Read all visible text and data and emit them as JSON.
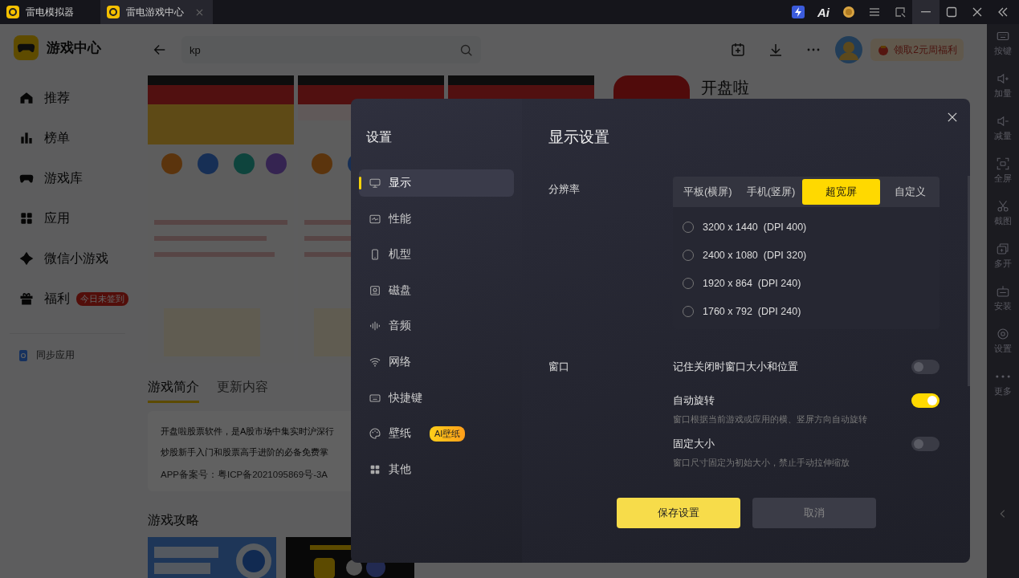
{
  "title_bar": {
    "tabs": [
      {
        "label": "雷电模拟器",
        "selected": false,
        "closable": false
      },
      {
        "label": "雷电游戏中心",
        "selected": true,
        "closable": true
      }
    ],
    "ai_label": "Ai"
  },
  "sidebar": {
    "title": "游戏中心",
    "items": [
      {
        "label": "推荐",
        "kind": "home"
      },
      {
        "label": "榜单",
        "kind": "chart"
      },
      {
        "label": "游戏库",
        "kind": "gamepad"
      },
      {
        "label": "应用",
        "kind": "apps"
      },
      {
        "label": "微信小游戏",
        "kind": "diamond"
      },
      {
        "label": "福利",
        "kind": "gift",
        "badge": "今日未签到"
      }
    ],
    "sync": "同步应用"
  },
  "header": {
    "search": {
      "value": "kp"
    },
    "reward_button": "领取2元周福利"
  },
  "app": {
    "name": "开盘啦",
    "tabs": [
      {
        "label": "游戏简介",
        "selected": true
      },
      {
        "label": "更新内容",
        "selected": false
      }
    ],
    "description_lines": [
      "开盘啦股票软件，是A股市场中集实时沪深行",
      "炒股新手入门和股票高手进阶的必备免费掌"
    ],
    "icp": "APP备案号：粤ICP备2021095869号-3A",
    "guides_title": "游戏攻略"
  },
  "right_toolbar": [
    {
      "label": "按键",
      "kind": "keyboard"
    },
    {
      "label": "加量",
      "kind": "volume-up"
    },
    {
      "label": "减量",
      "kind": "volume-down"
    },
    {
      "label": "全屏",
      "kind": "fullscreen"
    },
    {
      "label": "截图",
      "kind": "scissors"
    },
    {
      "label": "多开",
      "kind": "multi"
    },
    {
      "label": "安装",
      "kind": "install"
    },
    {
      "label": "设置",
      "kind": "settings"
    },
    {
      "label": "更多",
      "kind": "more"
    }
  ],
  "dialog": {
    "title": "设置",
    "nav": [
      {
        "label": "显示",
        "kind": "monitor",
        "selected": true
      },
      {
        "label": "性能",
        "kind": "pulse",
        "selected": false
      },
      {
        "label": "机型",
        "kind": "phone",
        "selected": false
      },
      {
        "label": "磁盘",
        "kind": "disk",
        "selected": false
      },
      {
        "label": "音频",
        "kind": "wave",
        "selected": false
      },
      {
        "label": "网络",
        "kind": "wifi",
        "selected": false
      },
      {
        "label": "快捷键",
        "kind": "keyboard",
        "selected": false
      },
      {
        "label": "壁纸",
        "kind": "palette",
        "selected": false,
        "badge": "AI壁纸"
      },
      {
        "label": "其他",
        "kind": "apps",
        "selected": false
      }
    ],
    "heading": "显示设置",
    "resolution_label": "分辨率",
    "modes": [
      {
        "label": "平板(横屏)",
        "selected": false
      },
      {
        "label": "手机(竖屏)",
        "selected": false
      },
      {
        "label": "超宽屏",
        "selected": true
      },
      {
        "label": "自定义",
        "selected": false
      }
    ],
    "resolutions": [
      {
        "label": "3200 x 1440  (DPI 400)",
        "selected": false
      },
      {
        "label": "2400 x 1080  (DPI 320)",
        "selected": false
      },
      {
        "label": "1920 x 864  (DPI 240)",
        "selected": false
      },
      {
        "label": "1760 x 792  (DPI 240)",
        "selected": false
      }
    ],
    "window_label": "窗口",
    "toggles": [
      {
        "label": "记住关闭时窗口大小和位置",
        "on": false
      },
      {
        "label": "自动旋转",
        "on": true,
        "description": "窗口根据当前游戏或应用的横、竖屏方向自动旋转"
      },
      {
        "label": "固定大小",
        "on": false,
        "description": "窗口尺寸固定为初始大小，禁止手动拉伸缩放"
      }
    ],
    "save_button": "保存设置",
    "cancel_button": "取消"
  }
}
